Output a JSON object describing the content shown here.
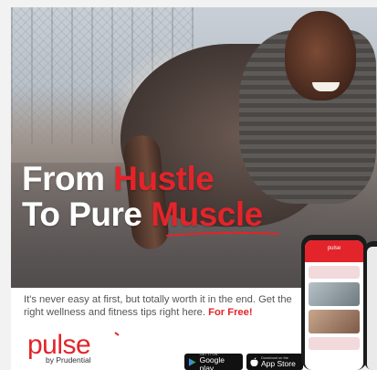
{
  "ad": {
    "headline": {
      "line1_white": "From ",
      "line1_red": "Hustle",
      "line2_white": "To Pure ",
      "line2_red": "Muscle"
    },
    "tagline": {
      "text": "It's never easy at first, but totally worth it in the end. Get the right wellness and fitness tips right here. ",
      "cta": "For Free!"
    },
    "brand": {
      "logo": "pulse",
      "byline": "by Prudential"
    },
    "stores": {
      "google_small": "GET IT ON",
      "google_big": "Google play",
      "apple_small": "Download on the",
      "apple_big": "App Store"
    },
    "phone_screen": {
      "header": "pulse"
    },
    "colors": {
      "accent": "#e3242b",
      "text": "#555555"
    },
    "icons": [
      "google-play-icon",
      "apple-icon"
    ]
  }
}
